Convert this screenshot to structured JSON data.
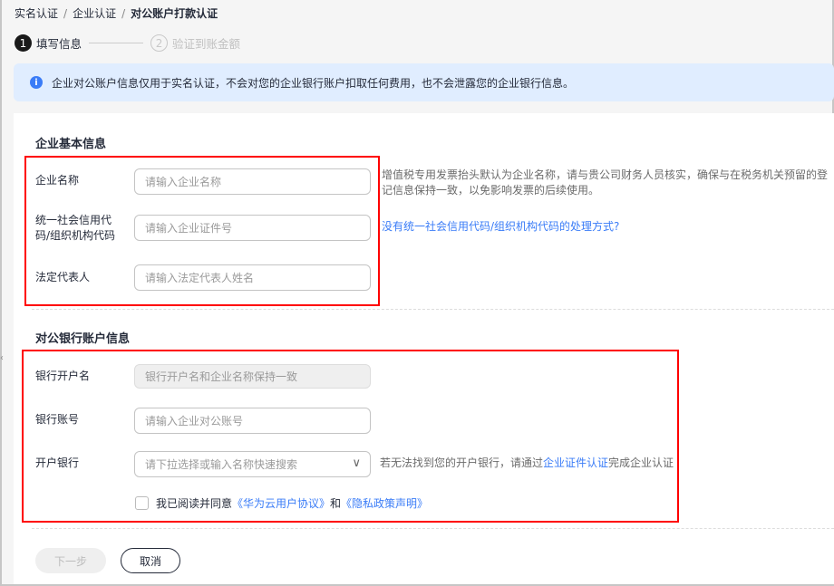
{
  "breadcrumb": [
    "实名认证",
    "企业认证",
    "对公账户打款认证"
  ],
  "steps": [
    {
      "num": "1",
      "label": "填写信息"
    },
    {
      "num": "2",
      "label": "验证到账金额"
    }
  ],
  "info": "企业对公账户信息仅用于实名认证，不会对您的企业银行账户扣取任何费用，也不会泄露您的企业银行信息。",
  "section1": {
    "title": "企业基本信息",
    "fields": [
      {
        "label": "企业名称",
        "placeholder": "请输入企业名称"
      },
      {
        "label": "统一社会信用代码/组织机构代码",
        "placeholder": "请输入企业证件号"
      },
      {
        "label": "法定代表人",
        "placeholder": "请输入法定代表人姓名"
      }
    ],
    "hint": "增值税专用发票抬头默认为企业名称，请与贵公司财务人员核实，确保与在税务机关预留的登记信息保持一致，以免影响发票的后续使用。",
    "link": "没有统一社会信用代码/组织机构代码的处理方式?"
  },
  "section2": {
    "title": "对公银行账户信息",
    "fields": [
      {
        "label": "银行开户名",
        "placeholder": "银行开户名和企业名称保持一致"
      },
      {
        "label": "银行账号",
        "placeholder": "请输入企业对公账号"
      },
      {
        "label": "开户银行",
        "placeholder": "请下拉选择或输入名称快速搜索"
      }
    ],
    "bank_hint_pre": "若无法找到您的开户银行，请通过",
    "bank_hint_link": "企业证件认证",
    "bank_hint_post": "完成企业认证",
    "agree_pre": "我已阅读并同意",
    "agree_link1": "《华为云用户协议》",
    "agree_mid": "和",
    "agree_link2": "《隐私政策声明》"
  },
  "buttons": {
    "next": "下一步",
    "cancel": "取消"
  }
}
